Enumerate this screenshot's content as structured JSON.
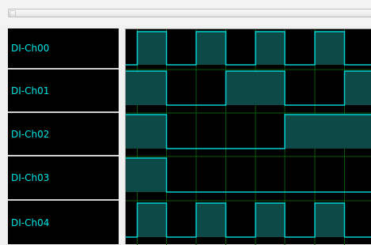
{
  "scrollbar": {
    "name": "horizontal-scrollbar"
  },
  "channels": [
    {
      "label": "DI-Ch00",
      "levels": [
        0,
        1,
        0,
        1,
        0,
        1,
        0,
        1,
        0
      ]
    },
    {
      "label": "DI-Ch01",
      "levels": [
        1,
        1,
        0,
        0,
        1,
        1,
        0,
        0,
        1
      ]
    },
    {
      "label": "DI-Ch02",
      "levels": [
        1,
        1,
        0,
        0,
        0,
        0,
        1,
        1,
        1
      ]
    },
    {
      "label": "DI-Ch03",
      "levels": [
        1,
        1,
        0,
        0,
        0,
        0,
        0,
        0,
        0
      ]
    },
    {
      "label": "DI-Ch04",
      "levels": [
        0,
        1,
        0,
        1,
        0,
        1,
        0,
        1,
        0
      ]
    }
  ],
  "colors": {
    "signal_line": "#00d0d0",
    "signal_fill": "#0d4a47",
    "grid": "#0b5a0b",
    "label_text": "#00e5e5",
    "background": "#000000"
  }
}
